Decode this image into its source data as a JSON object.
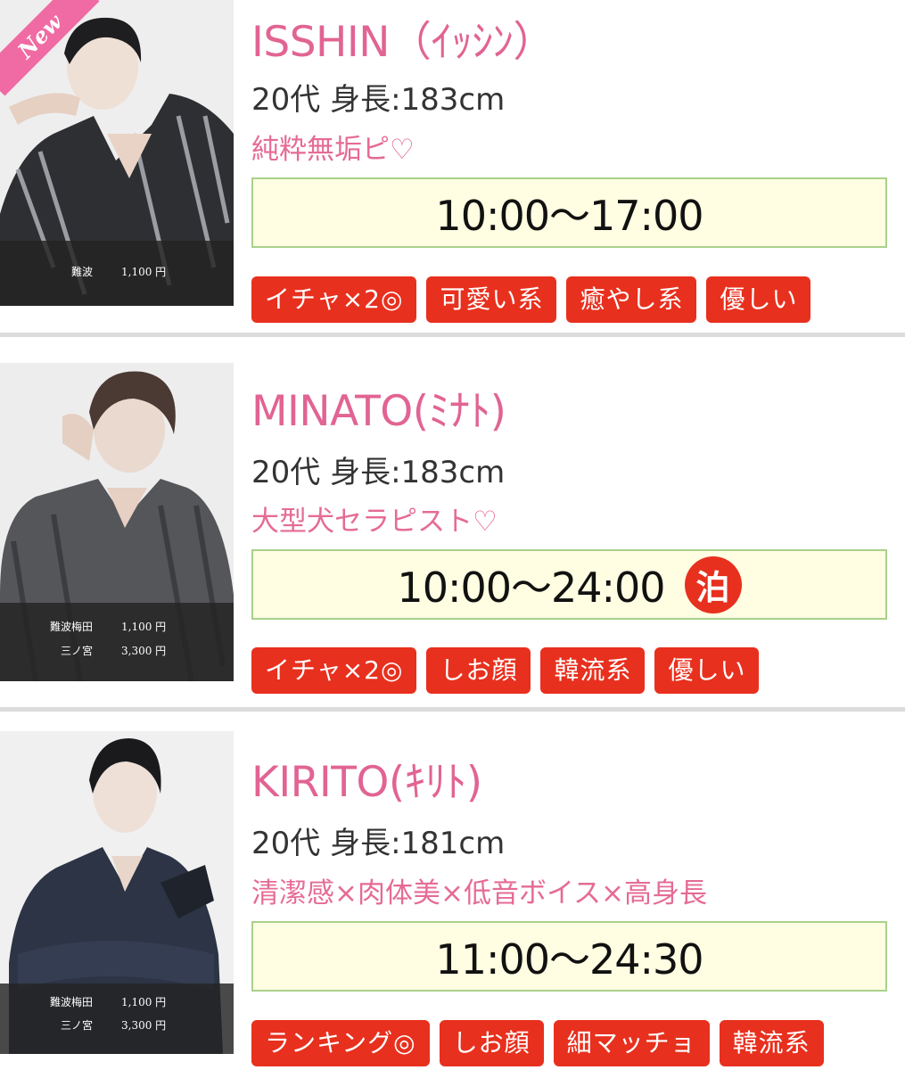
{
  "new_badge": "New",
  "casts": [
    {
      "name": "ISSHIN（ｲｯｼﾝ）",
      "meta": "20代 身長:183cm",
      "catch": "純粋無垢ピ♡",
      "time": "10:00〜17:00",
      "stay_badge": "",
      "prices": [
        {
          "location": "難波",
          "price": "1,100 円"
        }
      ],
      "tags": [
        "イチャ×2◎",
        "可愛い系",
        "癒やし系",
        "優しい"
      ]
    },
    {
      "name": "MINATO(ﾐﾅﾄ)",
      "meta": "20代 身長:183cm",
      "catch": "大型犬セラピスト♡",
      "time": "10:00〜24:00",
      "stay_badge": "泊",
      "prices": [
        {
          "location": "難波梅田",
          "price": "1,100 円"
        },
        {
          "location": "三ノ宮",
          "price": "3,300 円"
        }
      ],
      "tags": [
        "イチャ×2◎",
        "しお顔",
        "韓流系",
        "優しい"
      ]
    },
    {
      "name": "KIRITO(ｷﾘﾄ)",
      "meta": "20代 身長:181cm",
      "catch": "清潔感×肉体美×低音ボイス×高身長",
      "time": "11:00〜24:30",
      "stay_badge": "",
      "prices": [
        {
          "location": "難波梅田",
          "price": "1,100 円"
        },
        {
          "location": "三ノ宮",
          "price": "3,300 円"
        }
      ],
      "tags": [
        "ランキング◎",
        "しお顔",
        "細マッチョ",
        "韓流系"
      ]
    }
  ],
  "colors": {
    "name_pink": "#e16493",
    "tag_red": "#e8301e",
    "time_bg": "#fffde2",
    "time_border": "#a9d18b",
    "separator": "#dcdcdc"
  }
}
